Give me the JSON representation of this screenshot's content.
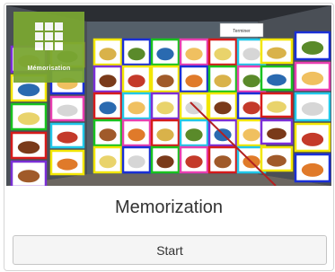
{
  "card": {
    "badge_label": "Mémorisation",
    "screen_button": "Terminer",
    "title": "Memorization",
    "start_label": "Start"
  },
  "colors": {
    "badge": "#7aa632",
    "frame_yellow": "#f2e600",
    "frame_blue": "#1a2fd6",
    "frame_green": "#19c21f",
    "frame_pink": "#e83fb0",
    "frame_red": "#d61b1b",
    "frame_cyan": "#21c7e8",
    "frame_purple": "#7a2fd6"
  },
  "icons": [
    "grid-icon"
  ]
}
